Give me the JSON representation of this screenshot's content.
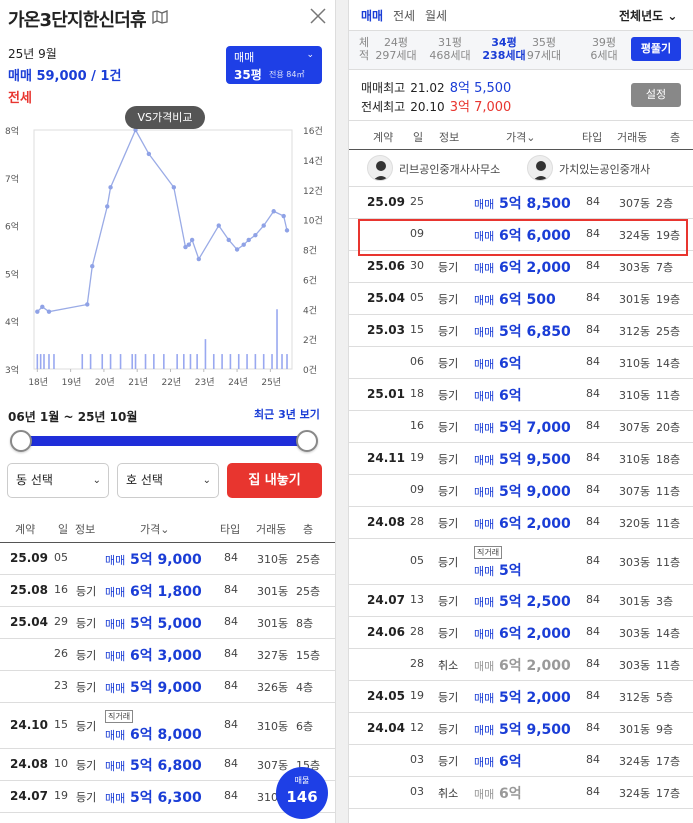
{
  "left": {
    "title": "가온3단지한신더휴",
    "month": "25년 9월",
    "deal_label": "매매",
    "deal_value": "59,000 / 1건",
    "jeonse_label": "전세",
    "select": {
      "type": "매매",
      "pyeong": "35평",
      "area": "전용 84㎡"
    },
    "vs_button": "VS가격비교",
    "chart_data": {
      "type": "line",
      "x_ticks": [
        "18년",
        "19년",
        "20년",
        "21년",
        "22년",
        "23년",
        "24년",
        "25년"
      ],
      "y_left_ticks": [
        "3억",
        "4억",
        "5억",
        "6억",
        "7억",
        "8억"
      ],
      "y_right_ticks": [
        "0건",
        "2건",
        "4건",
        "6건",
        "8건",
        "10건",
        "12건",
        "14건",
        "16건"
      ],
      "ylim_left": [
        3,
        8
      ],
      "ylim_right": [
        0,
        16
      ],
      "series": [
        {
          "x": [
            2018.0,
            2018.15,
            2018.35,
            2019.5,
            2019.65,
            2020.1,
            2020.2,
            2020.95,
            2021.35,
            2022.1,
            2022.45,
            2022.55,
            2022.65,
            2022.85,
            2023.45,
            2023.75,
            2024.0,
            2024.2,
            2024.35,
            2024.55,
            2024.8,
            2025.1,
            2025.4,
            2025.5
          ],
          "y": [
            4.2,
            4.3,
            4.2,
            4.35,
            5.15,
            6.4,
            6.8,
            8.0,
            7.5,
            6.8,
            5.55,
            5.6,
            5.7,
            5.3,
            6.0,
            5.7,
            5.5,
            5.6,
            5.7,
            5.8,
            6.0,
            6.3,
            6.2,
            5.9
          ]
        },
        {
          "x": [
            2018.0,
            2018.1,
            2018.2,
            2018.35,
            2018.5,
            2019.35,
            2019.6,
            2019.95,
            2020.2,
            2020.5,
            2020.85,
            2020.95,
            2021.25,
            2021.5,
            2021.8,
            2022.2,
            2022.4,
            2022.6,
            2022.8,
            2023.05,
            2023.3,
            2023.55,
            2023.8,
            2024.05,
            2024.3,
            2024.55,
            2024.8,
            2025.05,
            2025.2,
            2025.35,
            2025.5
          ],
          "y": [
            1,
            1,
            1,
            1,
            1,
            1,
            1,
            1,
            1,
            1,
            1,
            1,
            1,
            1,
            1,
            1,
            1,
            1,
            1,
            2,
            1,
            1,
            1,
            1,
            1,
            1,
            1,
            1,
            4,
            1,
            1
          ]
        }
      ]
    },
    "date_range": "06년 1월 ~ 25년 10월",
    "recent_link": "최근 3년 보기",
    "dong_select": "동 선택",
    "ho_select": "호 선택",
    "listing_button": "집 내놓기",
    "headers": {
      "contract": "계약",
      "day": "일",
      "info": "정보",
      "price": "가격",
      "type": "타입",
      "dong": "거래동",
      "floor": "층"
    },
    "rows": [
      {
        "date": "25.09",
        "day": "05",
        "info": "",
        "label": "매매",
        "price": "5억 9,000",
        "type": "84",
        "dong": "310동",
        "floor": "25층",
        "tag": ""
      },
      {
        "date": "25.08",
        "day": "16",
        "info": "등기",
        "label": "매매",
        "price": "6억 1,800",
        "type": "84",
        "dong": "301동",
        "floor": "25층",
        "tag": ""
      },
      {
        "date": "25.04",
        "day": "29",
        "info": "등기",
        "label": "매매",
        "price": "5억 5,000",
        "type": "84",
        "dong": "301동",
        "floor": "8층",
        "tag": ""
      },
      {
        "date": "",
        "day": "26",
        "info": "등기",
        "label": "매매",
        "price": "6억 3,000",
        "type": "84",
        "dong": "327동",
        "floor": "15층",
        "tag": ""
      },
      {
        "date": "",
        "day": "23",
        "info": "등기",
        "label": "매매",
        "price": "5억 9,000",
        "type": "84",
        "dong": "326동",
        "floor": "4층",
        "tag": ""
      },
      {
        "date": "24.10",
        "day": "15",
        "info": "등기",
        "label": "매매",
        "price": "6억 8,000",
        "type": "84",
        "dong": "310동",
        "floor": "6층",
        "tag": "직거래"
      },
      {
        "date": "24.08",
        "day": "10",
        "info": "등기",
        "label": "매매",
        "price": "5억 6,800",
        "type": "84",
        "dong": "307동",
        "floor": "15층",
        "tag": ""
      },
      {
        "date": "24.07",
        "day": "19",
        "info": "등기",
        "label": "매매",
        "price": "5억 6,300",
        "type": "84",
        "dong": "310동",
        "floor": "",
        "tag": ""
      }
    ],
    "fab": {
      "label": "매물",
      "count": "146"
    }
  },
  "right": {
    "tabs": [
      "매매",
      "전세",
      "월세"
    ],
    "year_select": "전체년도",
    "pyeong_label": "체적",
    "pyeong": [
      {
        "size": "24평",
        "units": "297세대"
      },
      {
        "size": "31평",
        "units": "468세대"
      },
      {
        "size": "34평",
        "units": "238세대"
      },
      {
        "size": "35평",
        "units": "97세대"
      },
      {
        "size": "39평",
        "units": "6세대"
      }
    ],
    "pyeong_button": "평풀기",
    "high_sale_label": "매매최고",
    "high_sale_date": "21.02",
    "high_sale_price": "8억 5,500",
    "high_jeonse_label": "전세최고",
    "high_jeonse_date": "20.10",
    "high_jeonse_price": "3억 7,000",
    "settings_button": "설정",
    "headers": {
      "contract": "계약",
      "day": "일",
      "info": "정보",
      "price": "가격",
      "type": "타입",
      "dong": "거래동",
      "floor": "층"
    },
    "agents": [
      "리브공인중개사사무소",
      "가치있는공인중개사"
    ],
    "rows": [
      {
        "date": "25.09",
        "day": "25",
        "info": "",
        "label": "매매",
        "price": "5억 8,500",
        "type": "84",
        "dong": "307동",
        "floor": "2층",
        "tag": "",
        "gray": false
      },
      {
        "date": "",
        "day": "09",
        "info": "",
        "label": "매매",
        "price": "6억 6,000",
        "type": "84",
        "dong": "324동",
        "floor": "19층",
        "tag": "",
        "gray": false
      },
      {
        "date": "25.06",
        "day": "30",
        "info": "등기",
        "label": "매매",
        "price": "6억 2,000",
        "type": "84",
        "dong": "303동",
        "floor": "7층",
        "tag": "",
        "gray": false
      },
      {
        "date": "25.04",
        "day": "05",
        "info": "등기",
        "label": "매매",
        "price": "6억 500",
        "type": "84",
        "dong": "301동",
        "floor": "19층",
        "tag": "",
        "gray": false
      },
      {
        "date": "25.03",
        "day": "15",
        "info": "등기",
        "label": "매매",
        "price": "5억 6,850",
        "type": "84",
        "dong": "312동",
        "floor": "25층",
        "tag": "",
        "gray": false
      },
      {
        "date": "",
        "day": "06",
        "info": "등기",
        "label": "매매",
        "price": "6억",
        "type": "84",
        "dong": "310동",
        "floor": "14층",
        "tag": "",
        "gray": false
      },
      {
        "date": "25.01",
        "day": "18",
        "info": "등기",
        "label": "매매",
        "price": "6억",
        "type": "84",
        "dong": "310동",
        "floor": "11층",
        "tag": "",
        "gray": false
      },
      {
        "date": "",
        "day": "16",
        "info": "등기",
        "label": "매매",
        "price": "5억 7,000",
        "type": "84",
        "dong": "307동",
        "floor": "20층",
        "tag": "",
        "gray": false
      },
      {
        "date": "24.11",
        "day": "19",
        "info": "등기",
        "label": "매매",
        "price": "5억 9,500",
        "type": "84",
        "dong": "310동",
        "floor": "18층",
        "tag": "",
        "gray": false
      },
      {
        "date": "",
        "day": "09",
        "info": "등기",
        "label": "매매",
        "price": "5억 9,000",
        "type": "84",
        "dong": "307동",
        "floor": "11층",
        "tag": "",
        "gray": false
      },
      {
        "date": "24.08",
        "day": "28",
        "info": "등기",
        "label": "매매",
        "price": "6억 2,000",
        "type": "84",
        "dong": "320동",
        "floor": "11층",
        "tag": "",
        "gray": false
      },
      {
        "date": "",
        "day": "05",
        "info": "등기",
        "label": "매매",
        "price": "5억",
        "type": "84",
        "dong": "303동",
        "floor": "11층",
        "tag": "직거래",
        "gray": false
      },
      {
        "date": "24.07",
        "day": "13",
        "info": "등기",
        "label": "매매",
        "price": "5억 2,500",
        "type": "84",
        "dong": "301동",
        "floor": "3층",
        "tag": "",
        "gray": false
      },
      {
        "date": "24.06",
        "day": "28",
        "info": "등기",
        "label": "매매",
        "price": "6억 2,000",
        "type": "84",
        "dong": "303동",
        "floor": "14층",
        "tag": "",
        "gray": false
      },
      {
        "date": "",
        "day": "28",
        "info": "취소",
        "label": "매매",
        "price": "6억 2,000",
        "type": "84",
        "dong": "303동",
        "floor": "11층",
        "tag": "",
        "gray": true
      },
      {
        "date": "24.05",
        "day": "19",
        "info": "등기",
        "label": "매매",
        "price": "5억 2,000",
        "type": "84",
        "dong": "312동",
        "floor": "5층",
        "tag": "",
        "gray": false
      },
      {
        "date": "24.04",
        "day": "12",
        "info": "등기",
        "label": "매매",
        "price": "5억 9,500",
        "type": "84",
        "dong": "301동",
        "floor": "9층",
        "tag": "",
        "gray": false
      },
      {
        "date": "",
        "day": "03",
        "info": "등기",
        "label": "매매",
        "price": "6억",
        "type": "84",
        "dong": "324동",
        "floor": "17층",
        "tag": "",
        "gray": false
      },
      {
        "date": "",
        "day": "03",
        "info": "취소",
        "label": "매매",
        "price": "6억",
        "type": "84",
        "dong": "324동",
        "floor": "17층",
        "tag": "",
        "gray": true
      }
    ]
  }
}
